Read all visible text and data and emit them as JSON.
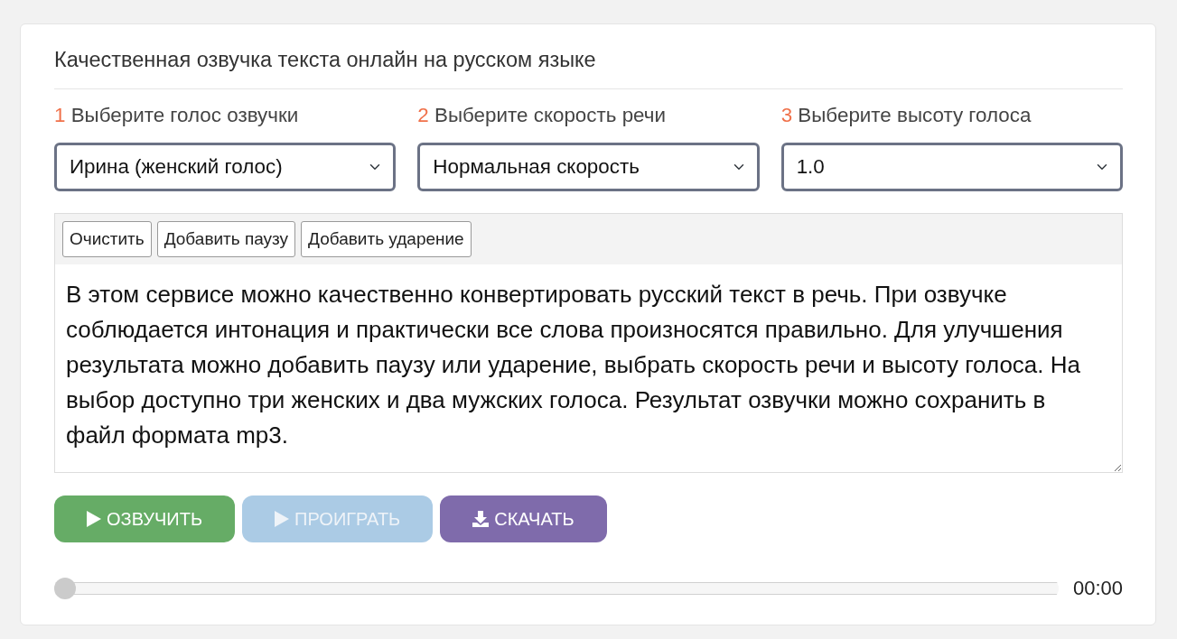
{
  "title": "Качественная озвучка текста онлайн на русском языке",
  "settings": [
    {
      "number": "1",
      "label": "Выберите голос озвучки",
      "value": "Ирина (женский голос)"
    },
    {
      "number": "2",
      "label": "Выберите скорость речи",
      "value": "Нормальная скорость"
    },
    {
      "number": "3",
      "label": "Выберите высоту голоса",
      "value": "1.0"
    }
  ],
  "toolbar": [
    "Очистить",
    "Добавить паузу",
    "Добавить ударение"
  ],
  "text": "В этом сервисе можно качественно конвертировать русский текст в речь. При озвучке соблюдается интонация и практически все слова произносятся правильно. Для улучшения результата можно добавить паузу или ударение, выбрать скорость речи и высоту голоса. На выбор доступно три женских и два мужских голоса. Результат озвучки можно сохранить в файл формата mp3.",
  "actions": [
    {
      "kind": "play",
      "label": "ОЗВУЧИТЬ",
      "color": "#66ac66",
      "disabled": false
    },
    {
      "kind": "play",
      "label": "ПРОИГРАТЬ",
      "color": "#abcbe5",
      "disabled": true
    },
    {
      "kind": "download",
      "label": "СКАЧАТЬ",
      "color": "#7f6bab",
      "disabled": false
    }
  ],
  "player": {
    "level": 0,
    "time": "00:00"
  }
}
